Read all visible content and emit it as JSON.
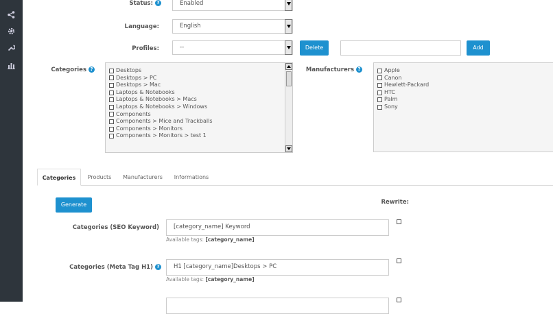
{
  "sidebar": {
    "icons": [
      "share-icon",
      "gear-icon",
      "wrench-icon",
      "bar-chart-icon"
    ]
  },
  "form": {
    "status": {
      "label": "Status:",
      "value": "Enabled"
    },
    "language": {
      "label": "Language:",
      "value": "English"
    },
    "profiles": {
      "label": "Profiles:",
      "value": "--",
      "delete_label": "Delete",
      "name_value": "",
      "add_label": "Add"
    }
  },
  "categories": {
    "label": "Categories",
    "items": [
      "Desktops",
      "Desktops > PC",
      "Desktops > Mac",
      "Laptops & Notebooks",
      "Laptops & Notebooks > Macs",
      "Laptops & Notebooks > Windows",
      "Components",
      "Components > Mice and Trackballs",
      "Components > Monitors",
      "Components > Monitors > test 1"
    ]
  },
  "manufacturers": {
    "label": "Manufacturers",
    "items": [
      "Apple",
      "Canon",
      "Hewlett-Packard",
      "HTC",
      "Palm",
      "Sony"
    ]
  },
  "tabs": [
    "Categories",
    "Products",
    "Manufacturers",
    "Informations"
  ],
  "generate_label": "Generate",
  "rewrite_label": "Rewrite:",
  "fields": [
    {
      "label": "Categories (SEO Keyword)",
      "value": "[category_name] Keyword",
      "hint_prefix": "Available tags: ",
      "hint_tag": "[category_name]"
    },
    {
      "label": "Categories (Meta Tag H1)",
      "value": "H1 [category_name]Desktops > PC",
      "hint_prefix": "Available tags: ",
      "hint_tag": "[category_name]"
    }
  ]
}
